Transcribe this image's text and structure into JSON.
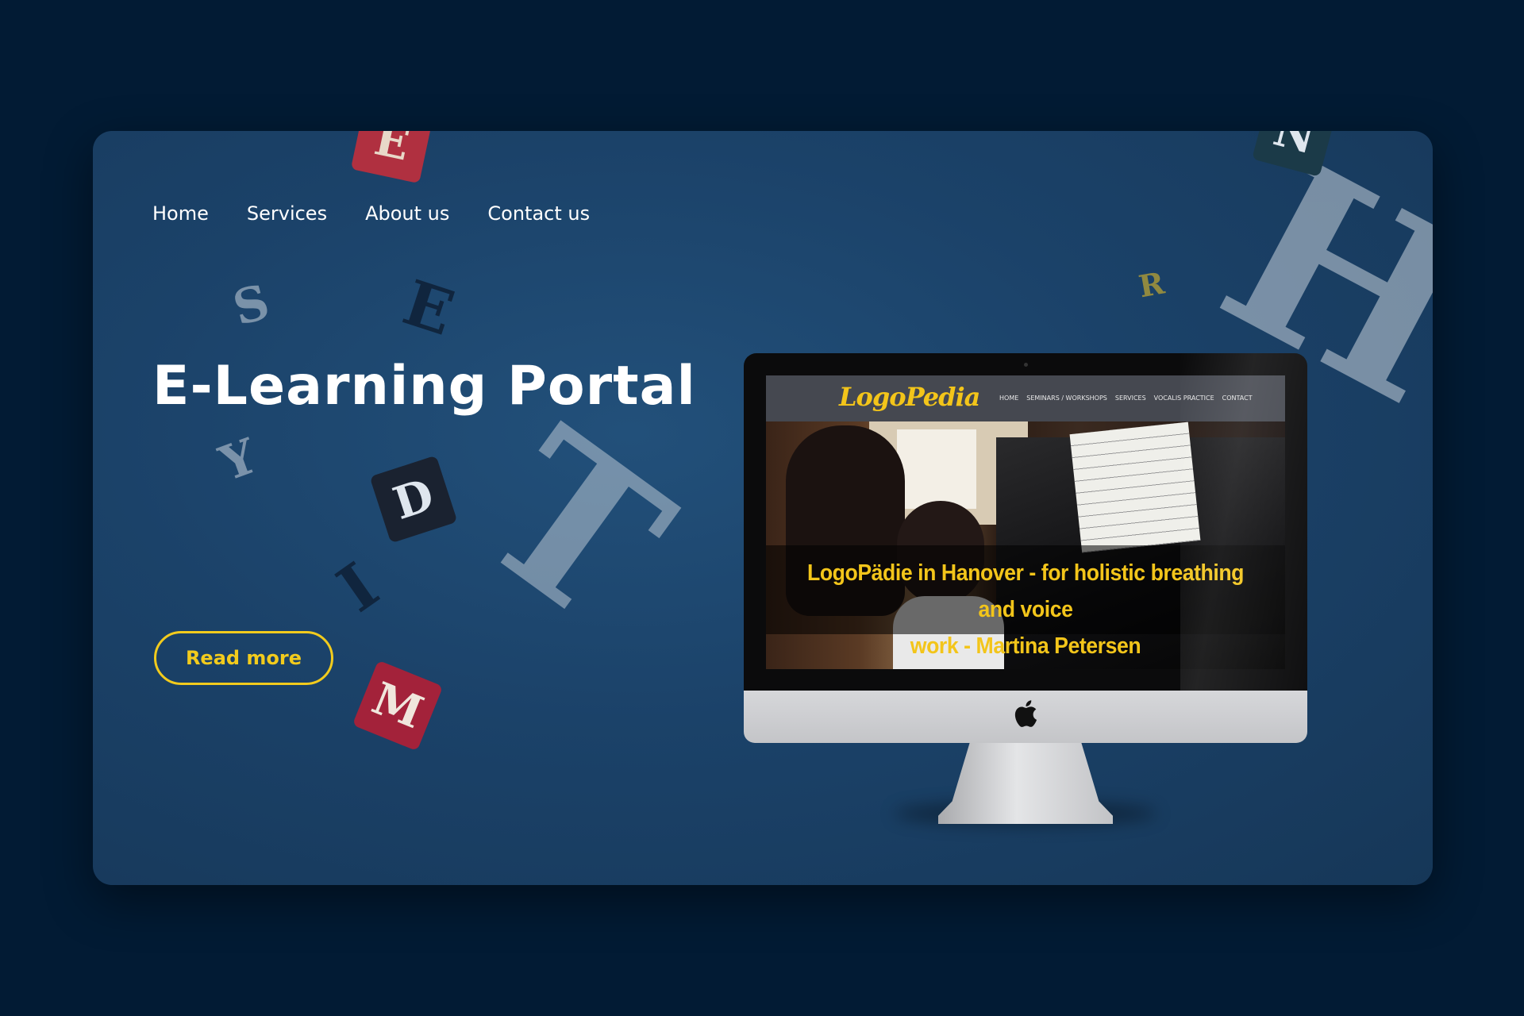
{
  "nav": {
    "items": [
      {
        "label": "Home"
      },
      {
        "label": "Services"
      },
      {
        "label": "About us"
      },
      {
        "label": "Contact us"
      }
    ]
  },
  "hero": {
    "title": "E-Learning Portal",
    "cta_label": "Read more"
  },
  "monitor": {
    "site_logo": "LogoPedia",
    "site_nav": [
      "HOME",
      "SEMINARS / WORKSHOPS",
      "SERVICES",
      "VOCALIS PRACTICE",
      "CONTACT"
    ],
    "headline_line1": "LogoPädie in Hanover - for holistic breathing and voice",
    "headline_line2": "work - Martina Petersen"
  },
  "decorations": {
    "letters": [
      "E",
      "S",
      "E",
      "Y",
      "D",
      "T",
      "I",
      "M",
      "R",
      "H",
      "N"
    ]
  },
  "colors": {
    "page_bg": "#021b34",
    "hero_bg": "#1b4269",
    "accent": "#f2cb1d",
    "text": "#ffffff"
  }
}
